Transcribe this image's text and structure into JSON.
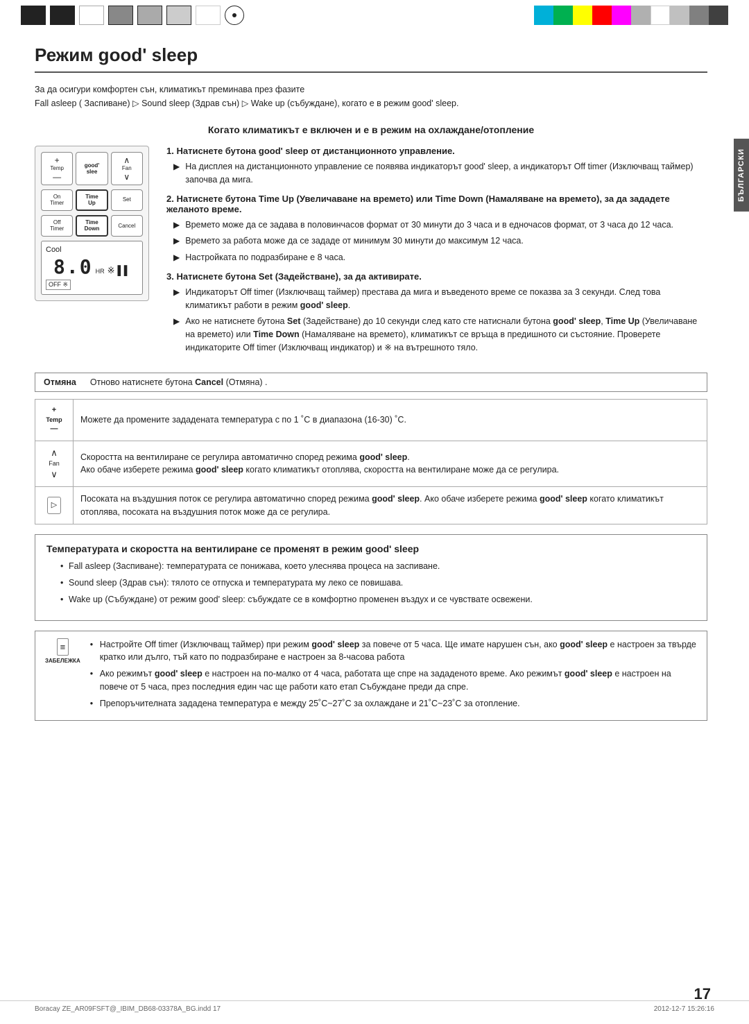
{
  "page": {
    "number": "17",
    "footer_left": "Boracay ZE_AR09FSFT@_IBIM_DB68-03378A_BG.indd  17",
    "footer_right": "2012-12-7  15:26:16"
  },
  "top_marks": {
    "color_bars": [
      "#00b0d8",
      "#00b050",
      "#ffff00",
      "#ff0000",
      "#ff00ff",
      "#b0b0b0",
      "#ffffff",
      "#c0c0c0",
      "#808080"
    ]
  },
  "side_label": "БЪЛГАРСКИ",
  "title": "Режим good' sleep",
  "intro": {
    "line1": "За да осигури комфортен сън, климатикът преминава през фазите",
    "line2": "Fall asleep ( Заспиване) ▷ Sound sleep (Здрав сън) ▷ Wake up (събуждане), когато е в режим good' sleep."
  },
  "section_header": "Когато климатикът е включен и е в режим на охлаждане/отопление",
  "steps": [
    {
      "number": "1.",
      "title": "Натиснете бутона good' sleep от дистанционното управление.",
      "bullets": [
        "На дисплея на дистанционното управление се появява индикаторът good' sleep, а индикаторът Off timer (Изключващ таймер) започва да мига."
      ]
    },
    {
      "number": "2.",
      "title": "Натиснете бутона Time Up (Увеличаване на времето) или Time Down (Намаляване на времето), за да зададете желаното време.",
      "bullets": [
        "Времето може да се задава в половинчасов формат от 30 минути до 3 часа и в едночасов формат, от 3 часа до 12 часа.",
        "Времето за работа може да се зададе от минимум 30 минути до максимум 12 часа.",
        "Настройката по подразбиране е 8 часа."
      ]
    },
    {
      "number": "3.",
      "title": "Натиснете бутона Set (Задействане), за да активирате.",
      "bullets": [
        "Индикаторът Off timer (Изключващ таймер) престава да мига и въведеното време се показва за 3 секунди. След това климатикът работи в режим good' sleep.",
        "Ако не натиснете бутона Set (Задействане) до 10 секунди след като сте натиснали бутона good' sleep, Time Up (Увеличаване на времето) или Time Down (Намаляване на времето), климатикът се връща в предишното си състояние. Проверете индикаторите Off timer (Изключващ индикатор) и ※ на вътрешното тяло."
      ]
    }
  ],
  "cancel_note": {
    "label": "Отмяна",
    "text": "Отново натиснете бутона Cancel (Отмяна) ."
  },
  "info_rows": [
    {
      "icon": "+ —",
      "icon_label": "Temp",
      "text": "Можете да промените зададената температура с по 1 ˚С в диапазона (16-30) ˚С."
    },
    {
      "icon": "∧ ∨",
      "icon_label": "Fan",
      "text_normal": "Скоростта на вентилиране се регулира автоматично според режима good' sleep.",
      "text_extra": "Ако обаче изберете режима good' sleep когато климатикът отоплява, скоростта на вентилиране може да се регулира."
    },
    {
      "icon": "▷",
      "icon_label": "",
      "text": "Посоката на въздушния поток се регулира автоматично според режима good' sleep. Ако обаче изберете режима good' sleep когато климатикът отоплява, посоката на въздушния поток може да се регулира."
    }
  ],
  "bottom_section": {
    "title": "Температурата и скоростта на вентилиране се променят в режим good' sleep",
    "bullets": [
      "Fall asleep (Заспиване): температурата се понижава, което улеснява процеса на заспиване.",
      "Sound sleep (Здрав сън): тялото се отпуска и температурата му леко се повишава.",
      "Wake up (Събуждане) от режим good' sleep: събуждате се в комфортно променен въздух и се чувствате освежени."
    ]
  },
  "note_box": {
    "icon_label": "ЗАБЕЛЕЖКА",
    "bullets": [
      "Настройте Off timer (Изключващ таймер) при режим good' sleep за повече от 5 часа. Ще имате нарушен сън, ако good' sleep е настроен за твърде кратко или дълго, тъй като по подразбиране е настроен за 8-часова работа",
      "Ако режимът good' sleep е настроен на по-малко от 4 часа, работата ще спре на зададеното време. Ако режимът good' sleep е настроен на повече от 5 часа, през последния един час ще работи като етап Събуждане преди да спре.",
      "Препоръчителната зададена температура е между 25˚С~27˚С за охлаждане и 21˚С~23˚С за отопление."
    ]
  },
  "remote": {
    "buttons": {
      "temp_label": "Temp",
      "fan_label": "Fan",
      "on_timer": "On\nTimer",
      "time_up": "Time\nUp",
      "set_label": "Set",
      "off_timer": "Off\nTimer",
      "time_down": "Time\nDown",
      "cancel_label": "Cancel",
      "good_sleep": "good'\nslee"
    },
    "display": {
      "cool": "Cool",
      "time": "8.0",
      "hr": "HR",
      "off": "OFF"
    }
  }
}
